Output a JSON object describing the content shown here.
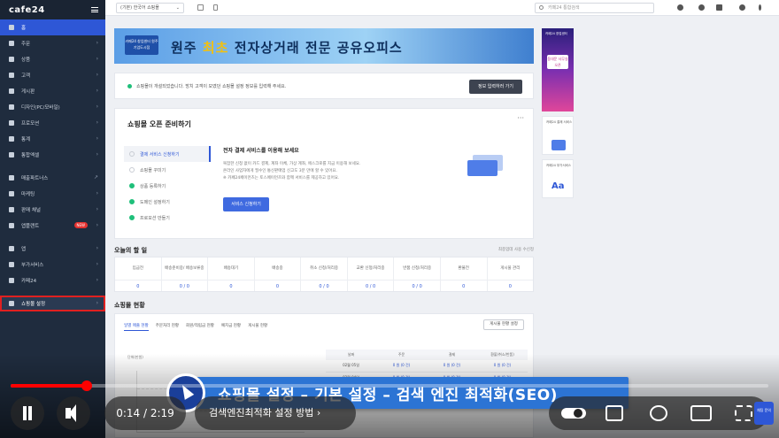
{
  "sidebar": {
    "logo": "cafe24",
    "items": [
      {
        "label": "홈"
      },
      {
        "label": "주문"
      },
      {
        "label": "상품"
      },
      {
        "label": "고객"
      },
      {
        "label": "게시판"
      },
      {
        "label": "디자인(PC/모바일)"
      },
      {
        "label": "프로모션"
      },
      {
        "label": "통계"
      },
      {
        "label": "통합엑셀"
      },
      {
        "label": "매출파트너스"
      },
      {
        "label": "마케팅"
      },
      {
        "label": "판매 채널"
      },
      {
        "label": "앱플랜트"
      },
      {
        "label": "앱"
      },
      {
        "label": "부가서비스"
      },
      {
        "label": "카페24"
      },
      {
        "label": "쇼핑몰 설정"
      }
    ],
    "new_badge": "NEW"
  },
  "topbar": {
    "shop_select": "(기본) 한국어 쇼핑몰",
    "search_placeholder": "카페24 통합검색"
  },
  "banner": {
    "badge": "카페24 창업센터 원주기업도시점",
    "title_a": "원주",
    "title_b": "최초",
    "title_c": "전자상거래 전문 공유오피스"
  },
  "notice": {
    "text": "쇼핑몰이 개설되었습니다. 방치 고객이 모였던 쇼핑몰 설정 정보를 입력해 주세요.",
    "button": "정보 입력하러 가기"
  },
  "setup": {
    "title": "쇼핑몰 오픈 준비하기",
    "more": "···",
    "steps": [
      {
        "label": "결제 서비스 신청하기"
      },
      {
        "label": "쇼핑몰 꾸미기"
      },
      {
        "label": "상품 등록하기"
      },
      {
        "label": "도메인 설정하기"
      },
      {
        "label": "프로모션 만들기"
      }
    ],
    "desc_title": "전자 결제 서비스를 이용해 보세요",
    "desc_lines": [
      "복잡한 신청 없이 카드 결제, 계좌 이체, 가상 계좌, 에스크로를 지금 이용해 보세요.",
      "온라인 사업자에게 필수인 통신판매업 신고도 3분 만에 할 수 있어요.",
      "※ 카페24페이먼츠는 토스페이먼츠와 함께 서비스를 제공하고 있어요."
    ],
    "desc_link": "토스페이먼츠",
    "button": "서비스 신청하기"
  },
  "todo": {
    "title": "오늘의 할 일",
    "updated": "최종업데 사용 수신정",
    "columns": [
      {
        "h": "입금전",
        "v": "0"
      },
      {
        "h": "배송준비중/ 배송보류중",
        "v": "0 / 0"
      },
      {
        "h": "배송대기",
        "v": "0"
      },
      {
        "h": "배송중",
        "v": "0"
      },
      {
        "h": "취소 신청/처리중",
        "v": "0 / 0"
      },
      {
        "h": "교환 신청/처리중",
        "v": "0 / 0"
      },
      {
        "h": "반품 신청/처리중",
        "v": "0 / 0"
      },
      {
        "h": "환불전",
        "v": "0"
      },
      {
        "h": "게시물 관리",
        "v": "0"
      }
    ]
  },
  "status": {
    "title": "쇼핑몰 현황",
    "tabs": [
      "일별 매출 현황",
      "주문처리 현황",
      "회원/적립금 현황",
      "예치금 현황",
      "게시물 현황"
    ],
    "settings_button": "게시물 현황 설정",
    "unit": "단위(만원)",
    "headers": [
      "날짜",
      "주문",
      "결제",
      "환불(취소/반품)"
    ],
    "rows": [
      [
        "02월 05일",
        "0 원 (0 건)",
        "0 원 (0 건)",
        "0 원 (0 건)"
      ],
      [
        "02월 04일",
        "0 원 (0 건)",
        "0 원 (0 건)",
        "0 원 (0 건)"
      ],
      [
        "02월 03일",
        "0 원 (0 건)",
        "0 원 (0 건)",
        "0 원 (0 건)"
      ]
    ]
  },
  "ads": [
    {
      "top": "카페24 창업센터",
      "label": "동대문 사무실 오픈"
    },
    {
      "top": "카페24 결제 서비스",
      "label": ""
    },
    {
      "top": "카페24 부가서비스",
      "label": "Aa"
    }
  ],
  "caption": "쇼핑몰 설정 – 기본 설정 – 검색 엔진 최적화(SEO)",
  "player": {
    "current": "0:14",
    "total": "2:19",
    "chapter": "검색엔진최적화 설정 방법",
    "progress": 0.1
  },
  "chat": "채팅 문의"
}
